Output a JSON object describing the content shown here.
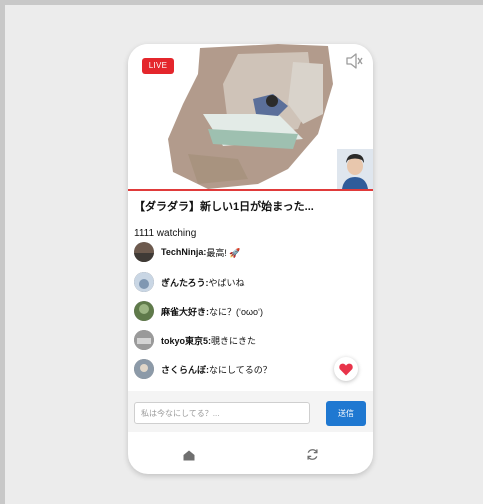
{
  "stream": {
    "live_label": "LIVE",
    "title": "【ダラダラ】新しい1日が始まった...",
    "watching": "1111 watching"
  },
  "icons": {
    "mute": "speaker-muted-icon",
    "like": "heart-icon",
    "home": "home-icon",
    "refresh": "refresh-icon"
  },
  "colors": {
    "live": "#e4262c",
    "accent_line": "#e03a3a",
    "send_button": "#1f78d1",
    "heart": "#e8344a"
  },
  "chat": [
    {
      "user": "TechNinja:",
      "message": " 最高! 🚀"
    },
    {
      "user": "ぎんたろう:",
      "message": " やばいね"
    },
    {
      "user": "麻雀大好き:",
      "message": " なに？(ʻoωoʻ)"
    },
    {
      "user": "tokyo東京5:",
      "message": " 覗きにきた"
    },
    {
      "user": "さくらんぼ:",
      "message": " なにしてるの？"
    }
  ],
  "composer": {
    "placeholder": "私は今なにしてる？...",
    "send_label": "送信"
  }
}
